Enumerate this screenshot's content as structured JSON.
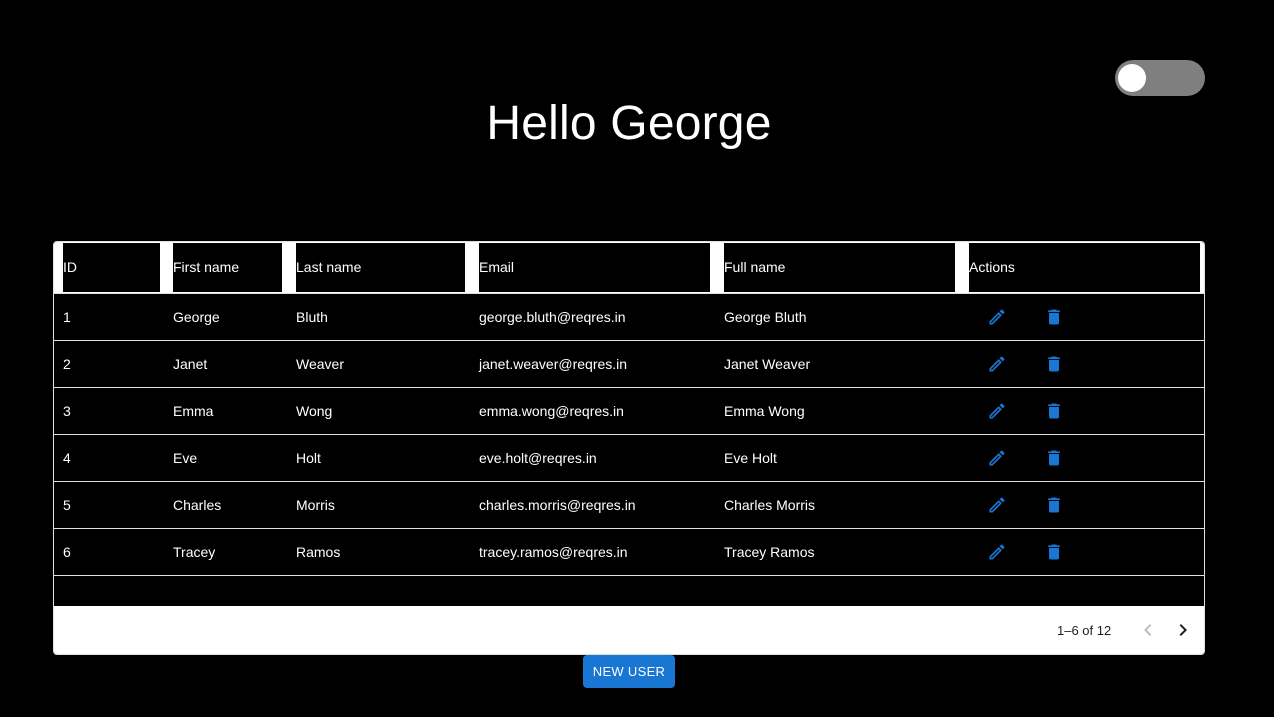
{
  "header": {
    "greeting": "Hello George"
  },
  "theme_toggle": {
    "state": "off"
  },
  "grid": {
    "columns": [
      "ID",
      "First name",
      "Last name",
      "Email",
      "Full name",
      "Actions"
    ],
    "rows": [
      {
        "id": "1",
        "first": "George",
        "last": "Bluth",
        "email": "george.bluth@reqres.in",
        "full": "George Bluth"
      },
      {
        "id": "2",
        "first": "Janet",
        "last": "Weaver",
        "email": "janet.weaver@reqres.in",
        "full": "Janet Weaver"
      },
      {
        "id": "3",
        "first": "Emma",
        "last": "Wong",
        "email": "emma.wong@reqres.in",
        "full": "Emma Wong"
      },
      {
        "id": "4",
        "first": "Eve",
        "last": "Holt",
        "email": "eve.holt@reqres.in",
        "full": "Eve Holt"
      },
      {
        "id": "5",
        "first": "Charles",
        "last": "Morris",
        "email": "charles.morris@reqres.in",
        "full": "Charles Morris"
      },
      {
        "id": "6",
        "first": "Tracey",
        "last": "Ramos",
        "email": "tracey.ramos@reqres.in",
        "full": "Tracey Ramos"
      }
    ],
    "row_actions": [
      "pencil-icon",
      "trash-icon"
    ],
    "pagination": {
      "label": "1–6 of 12",
      "prev_icon": "chevron-left-icon",
      "next_icon": "chevron-right-icon"
    }
  },
  "actions": {
    "new_user_label": "NEW USER"
  },
  "colors": {
    "background": "#000000",
    "accent": "#1976d2",
    "toggle_track": "#7f7f7f"
  }
}
